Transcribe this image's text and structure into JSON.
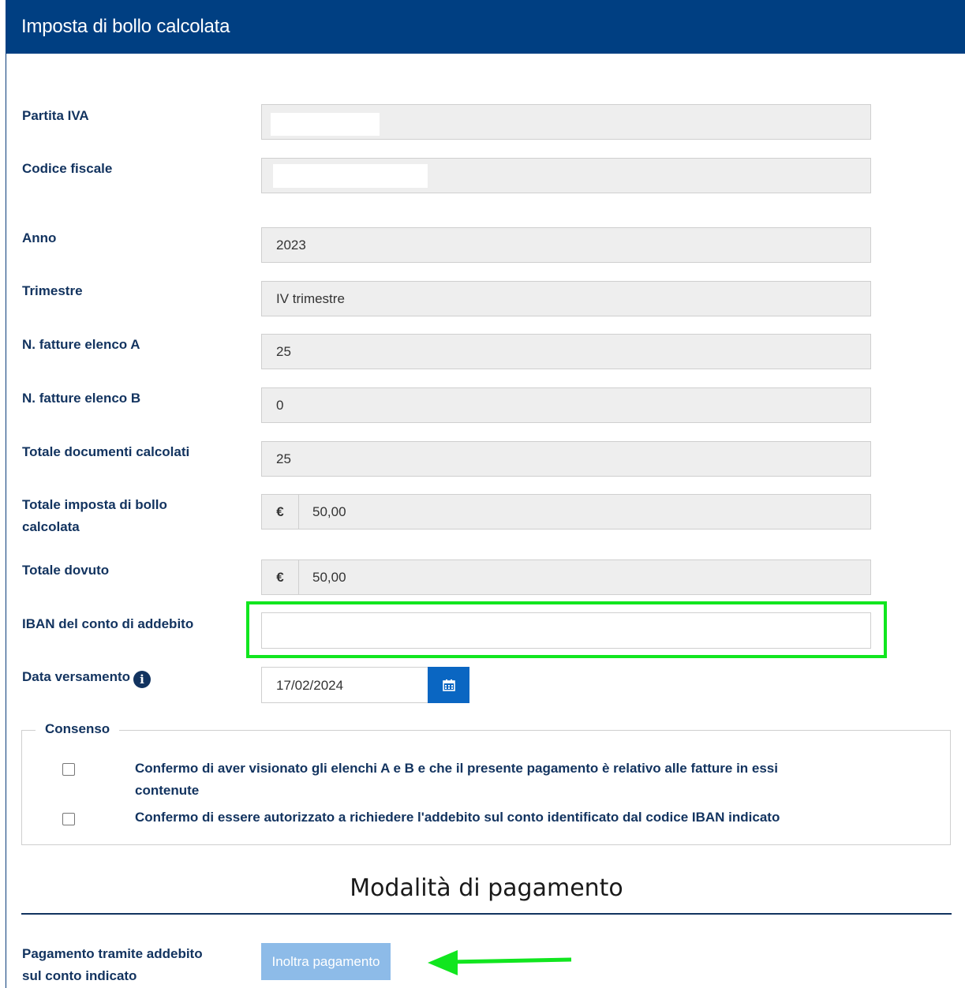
{
  "header": {
    "title": "Imposta di bollo calcolata"
  },
  "fields": {
    "partita_iva": {
      "label": "Partita IVA",
      "value": ""
    },
    "codice_fiscale": {
      "label": "Codice fiscale",
      "value": ""
    },
    "anno": {
      "label": "Anno",
      "value": "2023"
    },
    "trimestre": {
      "label": "Trimestre",
      "value": "IV trimestre"
    },
    "fatture_a": {
      "label": "N. fatture elenco A",
      "value": "25"
    },
    "fatture_b": {
      "label": "N. fatture elenco B",
      "value": "0"
    },
    "totale_documenti": {
      "label": "Totale documenti calcolati",
      "value": "25"
    },
    "totale_imposta": {
      "label_line1": "Totale imposta di bollo",
      "label_line2": "calcolata",
      "currency": "€",
      "value": "50,00"
    },
    "totale_dovuto": {
      "label": "Totale dovuto",
      "currency": "€",
      "value": "50,00"
    },
    "iban": {
      "label": "IBAN del conto di addebito",
      "value": ""
    },
    "data_versamento": {
      "label": "Data versamento",
      "value": "17/02/2024"
    }
  },
  "consenso": {
    "legend": "Consenso",
    "items": [
      {
        "line1": "Confermo di aver visionato gli elenchi A e B e che il presente pagamento è relativo alle fatture in essi",
        "line2": "contenute",
        "checked": false
      },
      {
        "line1": "Confermo di essere autorizzato a richiedere l'addebito sul conto identificato dal codice IBAN indicato",
        "checked": false
      }
    ]
  },
  "pagamento": {
    "section_title": "Modalità di pagamento",
    "label_line1": "Pagamento tramite addebito",
    "label_line2": "sul conto indicato",
    "button_label": "Inoltra pagamento"
  },
  "colors": {
    "header": "#003f82",
    "highlight": "#11e61f",
    "button": "#8dbbe8",
    "calendar_button": "#0a66c2"
  },
  "icons": [
    "info-icon",
    "calendar-icon",
    "arrow-icon"
  ]
}
